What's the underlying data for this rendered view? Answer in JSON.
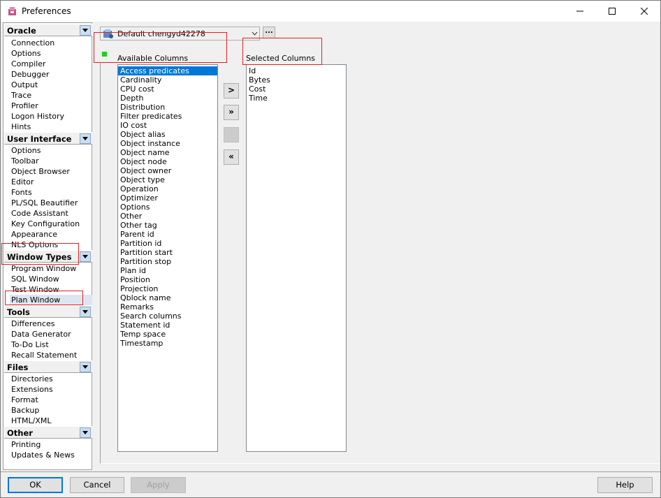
{
  "window": {
    "title": "Preferences",
    "icon": "app-icon",
    "controls": [
      "minimize-icon",
      "maximize-icon",
      "close-icon"
    ]
  },
  "sidebar": {
    "groups": [
      {
        "label": "Oracle",
        "items": [
          "Connection",
          "Options",
          "Compiler",
          "Debugger",
          "Output",
          "Trace",
          "Profiler",
          "Logon History",
          "Hints"
        ]
      },
      {
        "label": "User Interface",
        "items": [
          "Options",
          "Toolbar",
          "Object Browser",
          "Editor",
          "Fonts",
          "PL/SQL Beautifier",
          "Code Assistant",
          "Key Configuration",
          "Appearance",
          "NLS Options"
        ]
      },
      {
        "label": "Window Types",
        "items": [
          "Program Window",
          "SQL Window",
          "Test Window",
          "Plan Window"
        ]
      },
      {
        "label": "Tools",
        "items": [
          "Differences",
          "Data Generator",
          "To-Do List",
          "Recall Statement"
        ]
      },
      {
        "label": "Files",
        "items": [
          "Directories",
          "Extensions",
          "Format",
          "Backup",
          "HTML/XML"
        ]
      },
      {
        "label": "Other",
        "items": [
          "Printing",
          "Updates & News"
        ]
      }
    ],
    "selected_item": "Plan Window"
  },
  "main": {
    "profile": "Default chengyd42278",
    "profile_button": "...",
    "available_label": "Available Columns",
    "selected_label": "Selected Columns",
    "available_columns": [
      "Access predicates",
      "Cardinality",
      "CPU cost",
      "Depth",
      "Distribution",
      "Filter predicates",
      "IO cost",
      "Object alias",
      "Object instance",
      "Object name",
      "Object node",
      "Object owner",
      "Object type",
      "Operation",
      "Optimizer",
      "Options",
      "Other",
      "Other tag",
      "Parent id",
      "Partition id",
      "Partition start",
      "Partition stop",
      "Plan id",
      "Position",
      "Projection",
      "Qblock name",
      "Remarks",
      "Search columns",
      "Statement id",
      "Temp space",
      "Timestamp"
    ],
    "available_selected": "Access predicates",
    "selected_columns": [
      "Id",
      "Bytes",
      "Cost",
      "Time"
    ],
    "move_buttons": [
      ">",
      "»",
      "",
      "«"
    ]
  },
  "footer": {
    "ok": "OK",
    "cancel": "Cancel",
    "apply": "Apply",
    "help": "Help"
  },
  "colors": {
    "selection": "#0078d7",
    "annotation": "#e02020",
    "indicator": "#1bd11b"
  }
}
